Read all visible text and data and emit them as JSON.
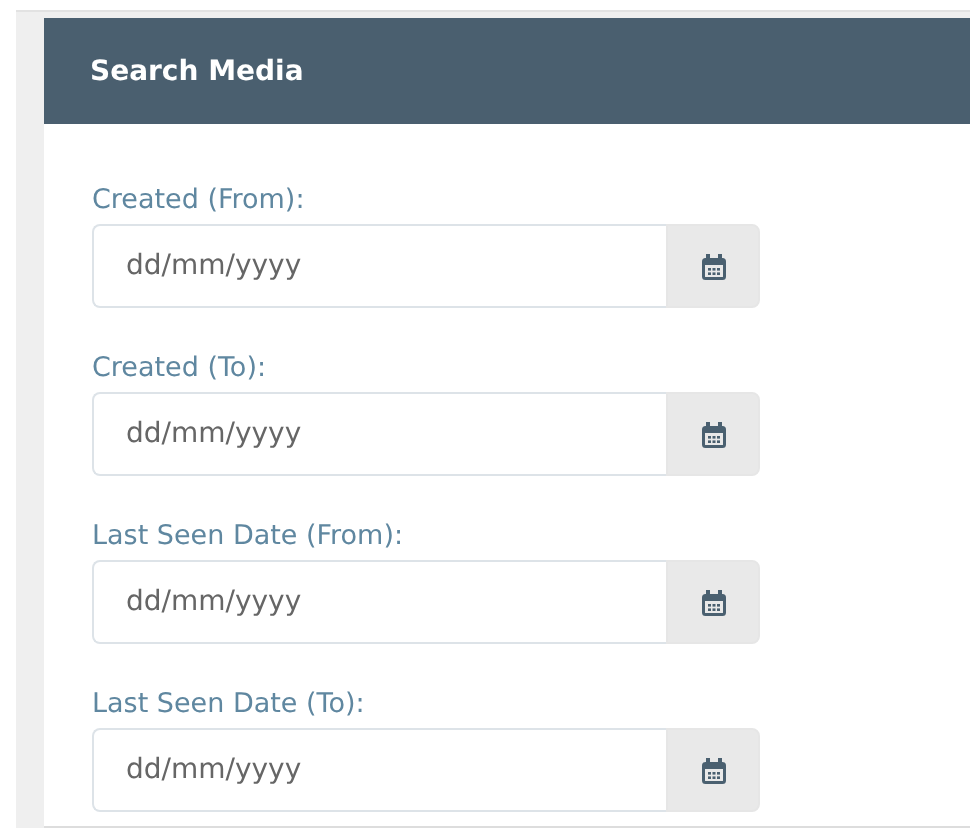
{
  "panel": {
    "title": "Search Media"
  },
  "fields": [
    {
      "label": "Created (From):",
      "placeholder": "dd/mm/yyyy"
    },
    {
      "label": "Created (To):",
      "placeholder": "dd/mm/yyyy"
    },
    {
      "label": "Last Seen Date (From):",
      "placeholder": "dd/mm/yyyy"
    },
    {
      "label": "Last Seen Date (To):",
      "placeholder": "dd/mm/yyyy"
    }
  ]
}
